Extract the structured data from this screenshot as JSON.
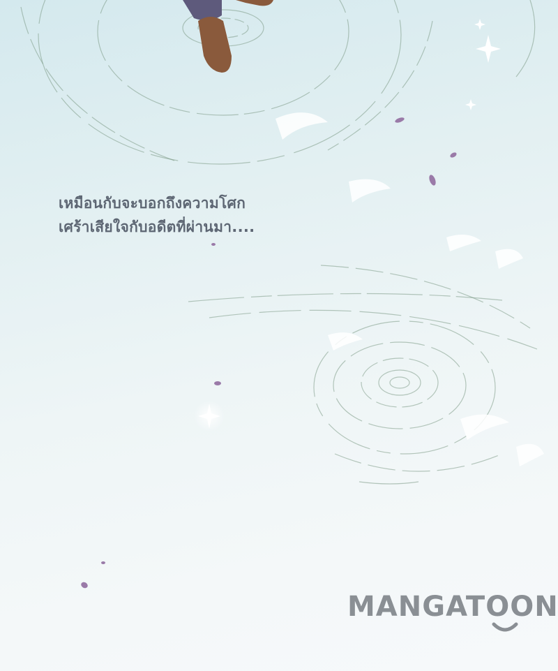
{
  "panel": {
    "narration_lines": [
      "เหมือนกับจะบอกถึงความโศก",
      "เศร้าเสียใจกับอดีตที่ผ่านมา...."
    ]
  },
  "watermark": {
    "text": "MANGATOON"
  },
  "colors": {
    "background_top": "#d4e9ee",
    "background_bottom": "#f6f9fa",
    "narration_text": "#5d6673",
    "ripple_stroke": "#7d9a86",
    "petal": "#9a7aa8",
    "boot": "#8a5a3c",
    "watermark": "#8a8f94"
  }
}
